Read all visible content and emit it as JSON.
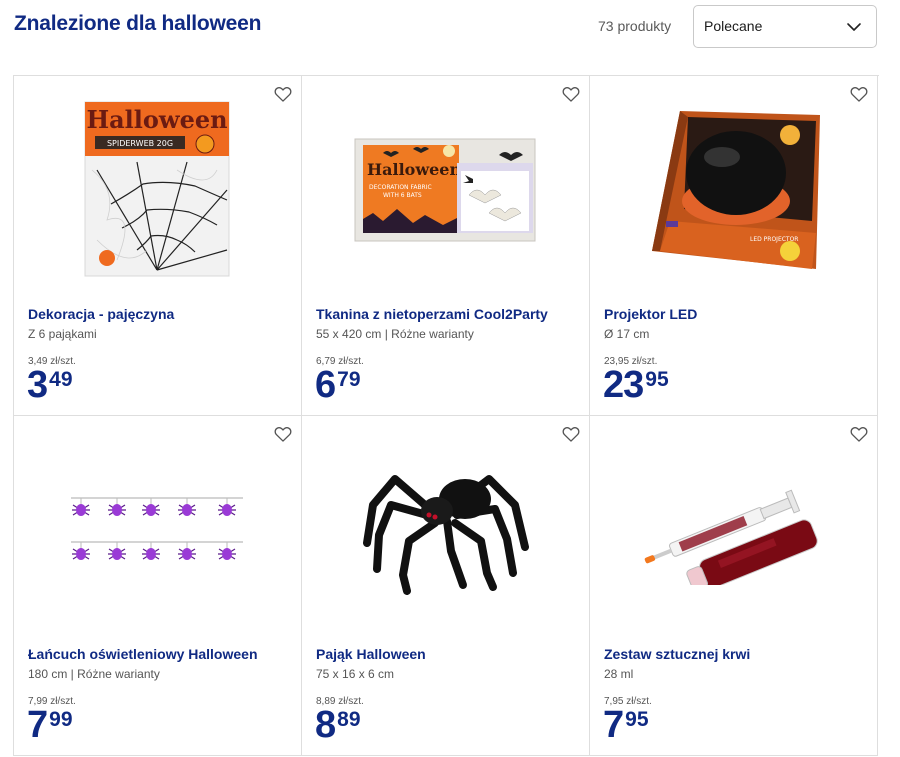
{
  "header": {
    "title": "Znalezione dla halloween",
    "count": "73 produkty",
    "sort_label": "Polecane"
  },
  "products": [
    {
      "name": "Dekoracja - pajęczyna",
      "sub": "Z 6 pająkami",
      "unit": "3,49 zł/szt.",
      "int": "3",
      "dec": "49",
      "image": "spider-web-package"
    },
    {
      "name": "Tkanina z nietoperzami Cool2Party",
      "sub": "55 x 420 cm | Różne warianty",
      "unit": "6,79 zł/szt.",
      "int": "6",
      "dec": "79",
      "image": "bat-fabric-package"
    },
    {
      "name": "Projektor LED",
      "sub": "Ø 17 cm",
      "unit": "23,95 zł/szt.",
      "int": "23",
      "dec": "95",
      "image": "led-projector-box"
    },
    {
      "name": "Łańcuch oświetleniowy Halloween",
      "sub": "180 cm | Różne warianty",
      "unit": "7,99 zł/szt.",
      "int": "7",
      "dec": "99",
      "image": "spider-light-chain"
    },
    {
      "name": "Pająk Halloween",
      "sub": "75 x 16 x 6 cm",
      "unit": "8,89 zł/szt.",
      "int": "8",
      "dec": "89",
      "image": "black-spider"
    },
    {
      "name": "Zestaw sztucznej krwi",
      "sub": "28 ml",
      "unit": "7,95 zł/szt.",
      "int": "7",
      "dec": "95",
      "image": "fake-blood-kit"
    }
  ],
  "colors": {
    "accent": "#102a83",
    "border": "#dedede",
    "text_muted": "#555555"
  },
  "icons": {
    "favorite": "heart-outline-icon",
    "sort": "chevron-down-icon"
  }
}
